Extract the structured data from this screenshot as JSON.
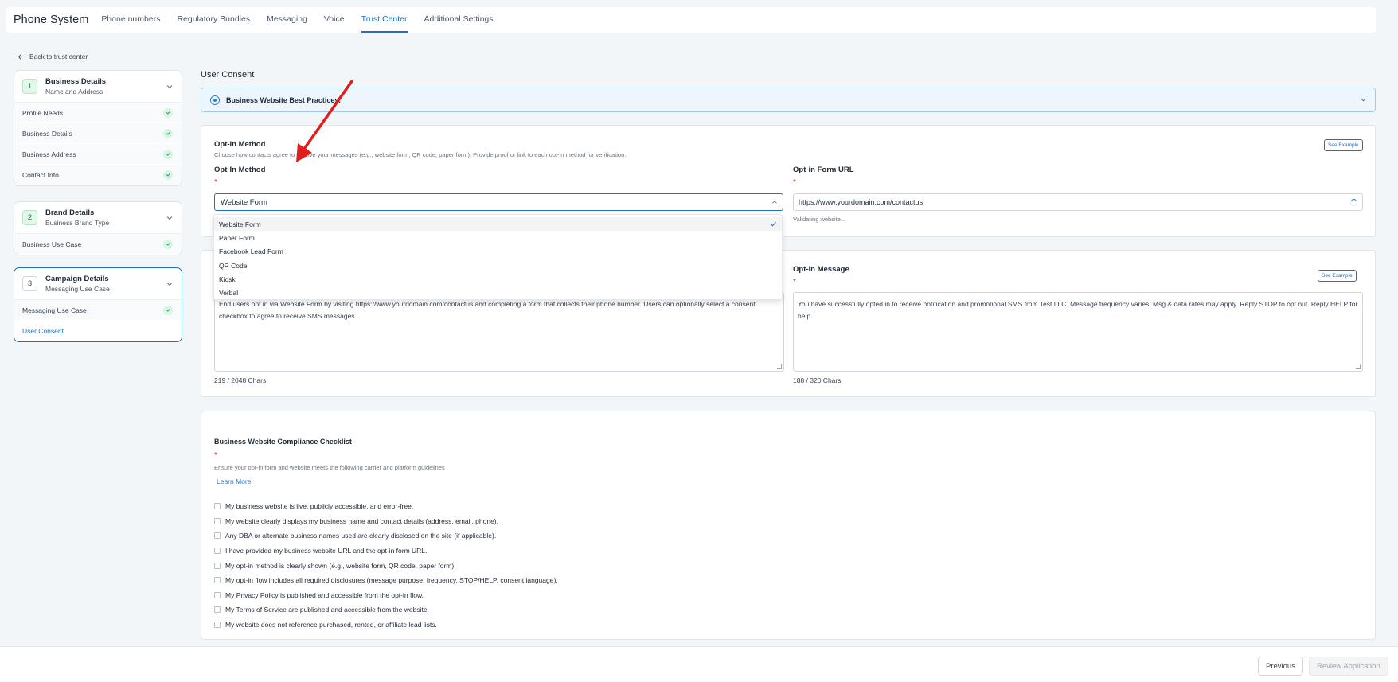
{
  "app": {
    "title": "Phone System"
  },
  "nav": {
    "tabs": [
      "Phone numbers",
      "Regulatory Bundles",
      "Messaging",
      "Voice",
      "Trust Center",
      "Additional Settings"
    ],
    "active": "Trust Center"
  },
  "sidebar": {
    "back_label": "Back to trust center",
    "steps": [
      {
        "number": "1",
        "title": "Business Details",
        "subtitle": "Name and Address",
        "items": [
          "Profile Needs",
          "Business Details",
          "Business Address",
          "Contact Info"
        ]
      },
      {
        "number": "2",
        "title": "Brand Details",
        "subtitle": "Business Brand Type",
        "items": [
          "Business Use Case"
        ]
      },
      {
        "number": "3",
        "title": "Campaign Details",
        "subtitle": "Messaging Use Case",
        "items": [
          "Messaging Use Case",
          "User Consent"
        ]
      }
    ]
  },
  "main": {
    "section_title": "User Consent",
    "banner_text": "Business Website Best Practices.",
    "optin": {
      "title": "Opt-In Method",
      "description": "Choose how contacts agree to receive your messages (e.g., website form, QR code, paper form). Provide proof or link to each opt-in method for verification.",
      "see_example": "See Example",
      "method_label": "Opt-In Method",
      "required_mark": "*",
      "selected_value": "Website Form",
      "url_label": "Opt-in Form URL",
      "url_value": "https://www.yourdomain.com/contactus",
      "url_status": "Validating website...",
      "options": [
        "Website Form",
        "Paper Form",
        "Facebook Lead Form",
        "QR Code",
        "Kiosk",
        "Verbal"
      ]
    },
    "flow": {
      "description_value": "End users opt in via Website Form by visiting https://www.yourdomain.com/contactus and completing a form that collects their phone number. Users can optionally select a consent checkbox to agree to receive SMS messages.",
      "description_count": "219 / 2048 Chars",
      "message_label": "Opt-in Message",
      "see_example": "See Example",
      "message_value": "You have successfully opted in to receive notification and promotional SMS from Test  LLC. Message frequency varies. Msg & data rates may apply. Reply STOP to opt out. Reply HELP for help.",
      "message_count": "188 / 320 Chars"
    },
    "checklist": {
      "title": "Business Website Compliance Checklist",
      "required_mark": "*",
      "description": "Ensure your opt-in form and website meets the following carrier and platform guidelines",
      "learn_more": "Learn More",
      "items": [
        "My business website is live, publicly accessible, and error-free.",
        "My website clearly displays my business name and contact details (address, email, phone).",
        "Any DBA or alternate business names used are clearly disclosed on the site (if applicable).",
        "I have provided my business website URL and the opt-in form URL.",
        "My opt-in method is clearly shown (e.g., website form, QR code, paper form).",
        "My opt-in flow includes all required disclosures (message purpose, frequency, STOP/HELP, consent language).",
        "My Privacy Policy is published and accessible from the opt-in flow.",
        "My Terms of Service are published and accessible from the website.",
        "My website does not reference purchased, rented, or affiliate lead lists."
      ]
    }
  },
  "footer": {
    "previous_label": "Previous",
    "review_label": "Review Application"
  },
  "colors": {
    "accent": "#1d71c4",
    "success": "#22a559",
    "annotation_arrow": "#e11d1d"
  }
}
